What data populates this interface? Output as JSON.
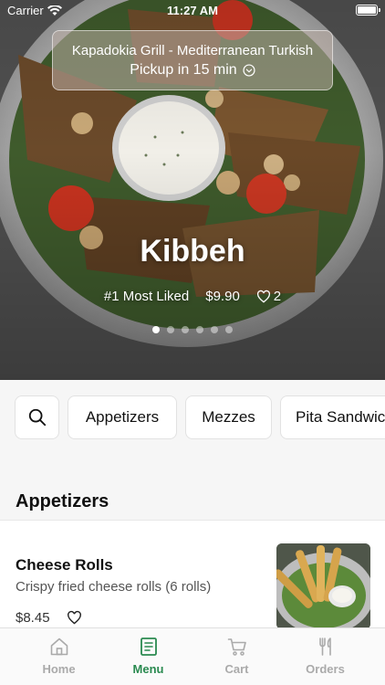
{
  "status": {
    "carrier": "Carrier",
    "time": "11:27 AM"
  },
  "store": {
    "name": "Kapadokia Grill - Mediterranean Turkish",
    "pickup": "Pickup in 15 min"
  },
  "featured": {
    "title": "Kibbeh",
    "badge": "#1 Most Liked",
    "price": "$9.90",
    "likes": "2",
    "carousel_total": 6,
    "carousel_active": 0
  },
  "categories": [
    "Appetizers",
    "Mezzes",
    "Pita Sandwic"
  ],
  "section": {
    "title": "Appetizers"
  },
  "items": [
    {
      "name": "Cheese Rolls",
      "description": "Crispy fried cheese rolls (6 rolls)",
      "price": "$8.45"
    }
  ],
  "tabs": [
    {
      "label": "Home",
      "icon": "home-icon"
    },
    {
      "label": "Menu",
      "icon": "menu-icon"
    },
    {
      "label": "Cart",
      "icon": "cart-icon"
    },
    {
      "label": "Orders",
      "icon": "fork-knife-icon"
    }
  ],
  "colors": {
    "accent": "#2a8a50",
    "inactive": "#aaaaaa"
  }
}
